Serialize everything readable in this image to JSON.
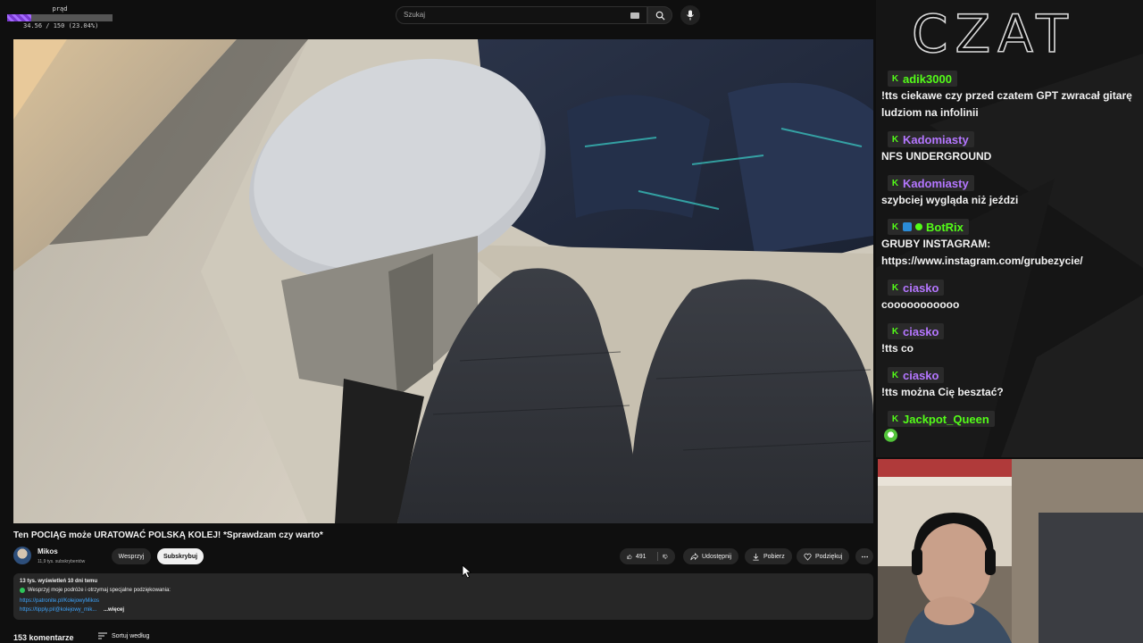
{
  "overlay": {
    "label": "prąd",
    "value_text": "34.56 / 150 (23.04%)",
    "fraction": 0.2304
  },
  "search": {
    "placeholder": "Szukaj",
    "icon": "search-icon",
    "mic_icon": "mic-icon",
    "keyboard_icon": "keyboard-icon"
  },
  "video": {
    "title": "Ten POCIĄG może URATOWAĆ POLSKĄ KOLEJ! *Sprawdzam czy warto*"
  },
  "channel": {
    "name": "Mikos",
    "subs": "11,9 tys. subskrybentów",
    "support_label": "Wesprzyj",
    "subscribe_label": "Subskrybuj"
  },
  "actions": {
    "likes": "491",
    "share": "Udostępnij",
    "download": "Pobierz",
    "thanks": "Podziękuj",
    "more_icon": "more-icon"
  },
  "description": {
    "stats": "13 tys. wyświetleń  10 dni temu",
    "line2": "Wesprzyj moje podróże i otrzymaj specjalne podziękowania:",
    "link1": "https://patronite.pl/KolejowyMikos",
    "link2": "https://tipply.pl/@kolejowy_mik...",
    "more": "...więcej"
  },
  "comments": {
    "count": "153 komentarze",
    "sort": "Sortuj według"
  },
  "chat": {
    "heading": "CZAT",
    "messages": [
      {
        "user": "adik3000",
        "text": "!tts ciekawe czy przed czatem GPT zwracał gitarę ludziom na infolinii"
      },
      {
        "user": "Kadomiasty",
        "text": "NFS UNDERGROUND"
      },
      {
        "user": "Kadomiasty",
        "text": "szybciej wygląda niż jeździ"
      },
      {
        "user": "BotRix",
        "text": "GRUBY INSTAGRAM: https://www.instagram.com/grubezycie/"
      },
      {
        "user": "ciasko",
        "text": "cooooooooooo"
      },
      {
        "user": "ciasko",
        "text": "!tts co"
      },
      {
        "user": "ciasko",
        "text": "!tts można Cię besztać?"
      },
      {
        "user": "Jackpot_Queen",
        "text": ""
      }
    ]
  },
  "colors": {
    "kick_green": "#53fc18",
    "purple": "#b476ff",
    "link_blue": "#3ea6ff"
  }
}
